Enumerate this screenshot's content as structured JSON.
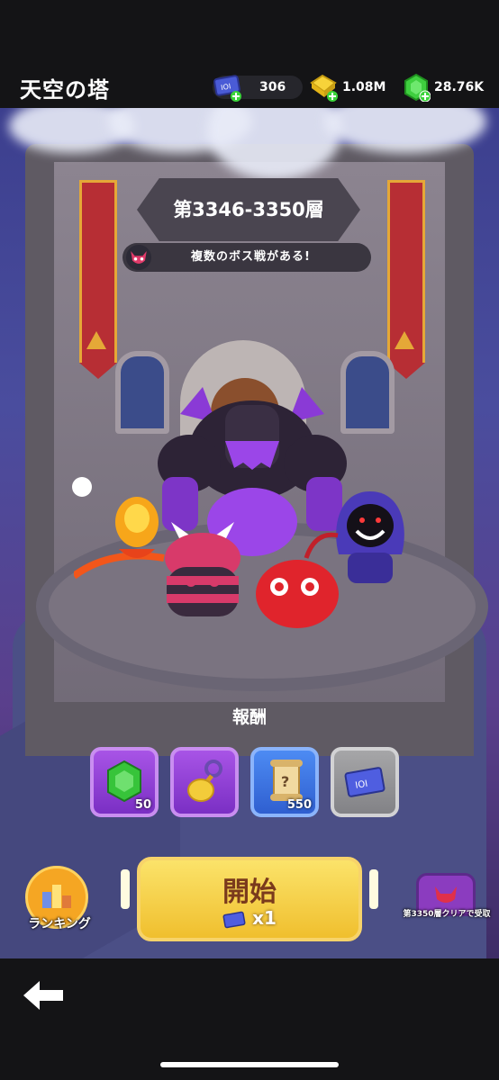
{
  "header": {
    "title": "天空の塔",
    "tickets": "306",
    "gold": "1.08M",
    "gems": "28.76K"
  },
  "tower": {
    "floor_range": "第3346-3350層",
    "boss_notice": "複数のボス戦がある!"
  },
  "rewards": {
    "title": "報酬",
    "items": [
      {
        "icon": "green-gem-icon",
        "count": "50"
      },
      {
        "icon": "golden-key-icon",
        "count": ""
      },
      {
        "icon": "scroll-icon",
        "count": "550"
      },
      {
        "icon": "ticket-icon",
        "count": ""
      }
    ]
  },
  "actions": {
    "start_label": "開始",
    "start_cost": "x1",
    "ranking_label": "ランキング",
    "chest_label": "第3350層クリアで受取"
  },
  "colors": {
    "start_button": "#f5cc45",
    "reward_purple": "#9a45dc",
    "reward_blue": "#3e76e6",
    "banner_red": "#b72e34"
  }
}
